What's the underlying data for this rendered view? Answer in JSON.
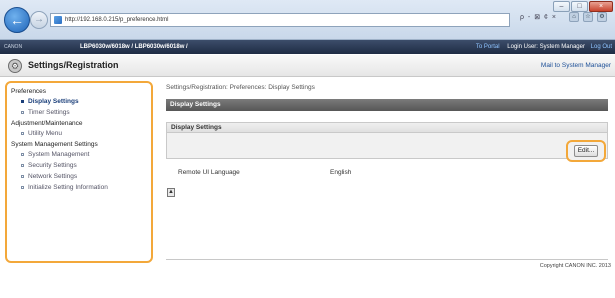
{
  "browser": {
    "url": "http://192.168.0.215/p_preference.html",
    "address_tools": "ρ - ⊠ ¢ ×",
    "back_icon": "arrow-left-icon",
    "forward_icon": "arrow-right-icon",
    "window_controls": [
      "–",
      "□",
      "×"
    ],
    "toolbar_icons": [
      "home-icon",
      "star-icon",
      "gear-icon"
    ]
  },
  "app_header": {
    "brand": "CANON",
    "printer_name": "LBP6030w/6018w / LBP6030w/6018w /",
    "portal_link": "To Portal",
    "login_user": "Login User: System Manager",
    "logout_link": "Log Out"
  },
  "page_header": {
    "title": "Settings/Registration",
    "mail_link": "Mail to System Manager",
    "icon": "settings-icon"
  },
  "sidebar": {
    "groups": [
      {
        "label": "Preferences",
        "items": [
          {
            "label": "Display Settings",
            "active": true
          },
          {
            "label": "Timer Settings",
            "active": false
          }
        ]
      },
      {
        "label": "Adjustment/Maintenance",
        "items": [
          {
            "label": "Utility Menu",
            "active": false
          }
        ]
      },
      {
        "label": "System Management Settings",
        "items": [
          {
            "label": "System Management",
            "active": false
          },
          {
            "label": "Security Settings",
            "active": false
          },
          {
            "label": "Network Settings",
            "active": false
          },
          {
            "label": "Initialize Setting Information",
            "active": false
          }
        ]
      }
    ]
  },
  "main": {
    "breadcrumb": "Settings/Registration: Preferences: Display Settings",
    "section_title": "Display Settings",
    "panel_title": "Display Settings",
    "edit_button": "Edit...",
    "settings": [
      {
        "label": "Remote UI Language",
        "value": "English"
      }
    ],
    "top_icon": "arrow-up-icon"
  },
  "footer": {
    "copyright": "Copyright CANON INC. 2013"
  },
  "colors": {
    "highlight": "#f3a83a",
    "title_bar": "#1f2c44",
    "section_bar": "#656565",
    "link": "#1c4f97"
  }
}
